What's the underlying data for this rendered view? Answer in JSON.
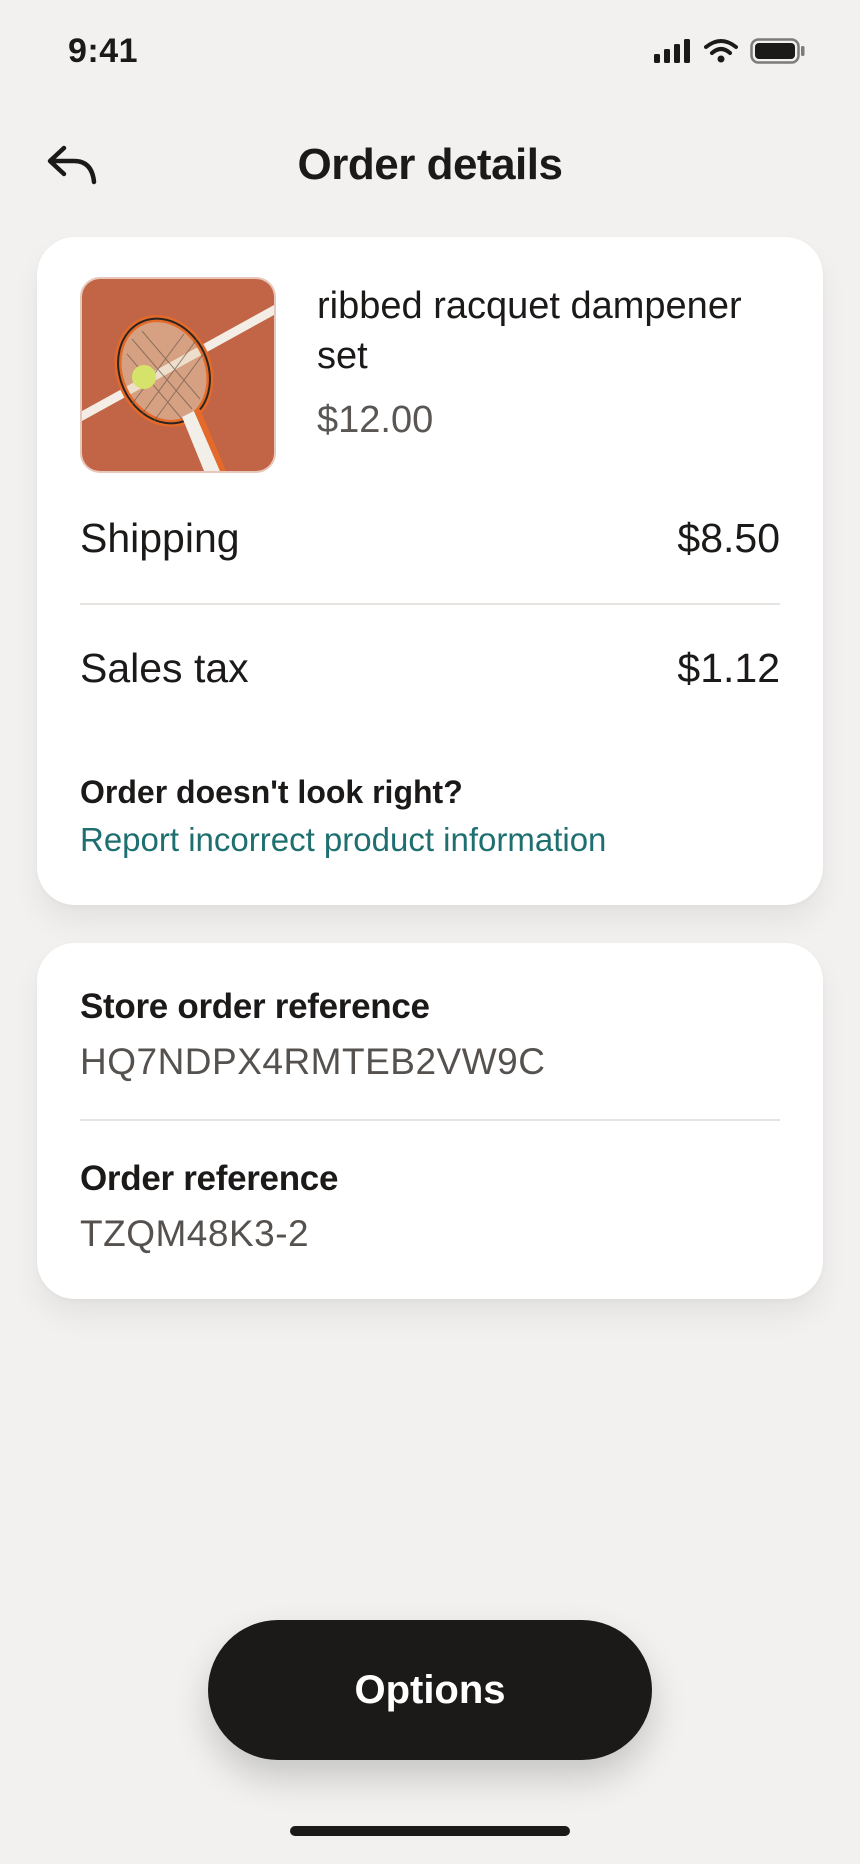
{
  "status_bar": {
    "time": "9:41",
    "icons": [
      "cellular-signal-icon",
      "wifi-icon",
      "battery-icon"
    ]
  },
  "header": {
    "title": "Order details",
    "back_icon": "back-arrow-icon"
  },
  "order": {
    "product": {
      "name": "ribbed racquet dampener set",
      "price": "$12.00",
      "image": "tennis-racquet-on-clay-court"
    },
    "lines": [
      {
        "label": "Shipping",
        "value": "$8.50"
      },
      {
        "label": "Sales tax",
        "value": "$1.12"
      }
    ],
    "help": {
      "title": "Order doesn't look right?",
      "link": "Report incorrect product information"
    }
  },
  "references": {
    "store": {
      "label": "Store order reference",
      "value": "HQ7NDPX4RMTEB2VW9C"
    },
    "order": {
      "label": "Order reference",
      "value": "TZQM48K3-2"
    }
  },
  "actions": {
    "options_label": "Options"
  },
  "colors": {
    "background": "#f2f1f0",
    "primary_button": "#1c1a19",
    "link": "#1f6f70",
    "card": "#ffffff"
  }
}
